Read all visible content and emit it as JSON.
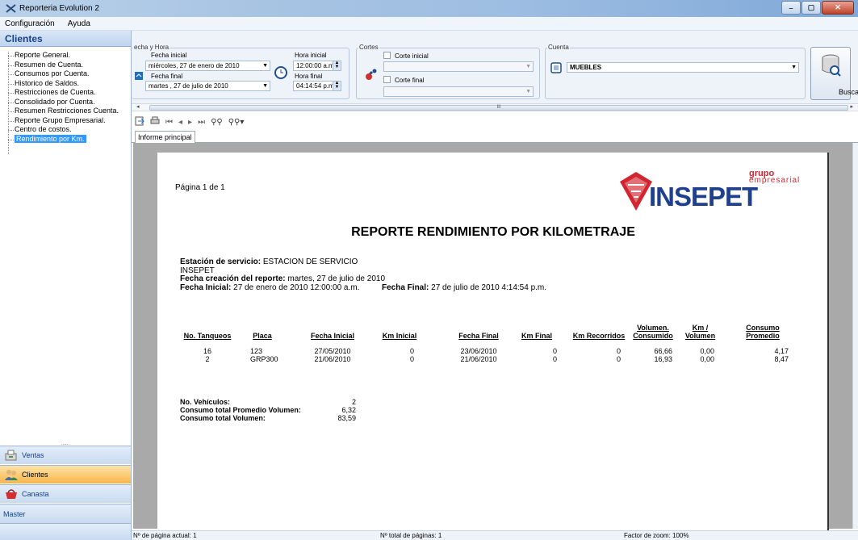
{
  "window": {
    "title": "Reporteria Evolution 2",
    "min": "–",
    "max": "▢",
    "close": "✕"
  },
  "menu": [
    "Configuración",
    "Ayuda"
  ],
  "left": {
    "header": "Clientes",
    "tree": [
      "Reporte General.",
      "Resumen de Cuenta.",
      "Consumos  por Cuenta.",
      "Historico de Saldos.",
      "Restricciones de Cuenta.",
      "Consolidado por Cuenta.",
      "Resumen Restricciones Cuenta.",
      "Reporte Grupo Empresarial.",
      "Centro de costos.",
      "Rendimiento por Km."
    ],
    "selected": 9,
    "splitter": "......",
    "nav": [
      {
        "label": "Ventas",
        "icon": "ventas-icon"
      },
      {
        "label": "Clientes",
        "icon": "clientes-icon"
      },
      {
        "label": "Canasta",
        "icon": "canasta-icon"
      },
      {
        "label": "Master",
        "icon": ""
      }
    ]
  },
  "filters": {
    "fecha_hora_title": "echa y Hora",
    "fecha_inicial_label": "Fecha inicial",
    "fecha_inicial_value": "miércoles, 27 de    enero     de 2010",
    "fecha_final_label": "Fecha final",
    "fecha_final_value": "martes  , 27 de    julio     de 2010",
    "hora_inicial_label": "Hora inicial",
    "hora_inicial_value": "12:00:00 a.m.",
    "hora_final_label": "Hora final",
    "hora_final_value": "04:14:54 p.m.",
    "cortes_title": "Cortes",
    "corte_inicial_label": "Corte inicial",
    "corte_final_label": "Corte final",
    "cuenta_title": "Cuenta",
    "cuenta_value": "MUEBLES",
    "buscar_label": "Buscar",
    "scroll_thumb": "III"
  },
  "tab": "Informe principal",
  "report": {
    "page_label": "Página 1 de 1",
    "logo_top": "grupo",
    "logo_sub": "empresarial",
    "logo_main": "INSEPET",
    "title": "REPORTE RENDIMIENTO POR KILOMETRAJE",
    "estacion_label": "Estación de servicio:",
    "estacion_value": " ESTACION DE SERVICIO",
    "estacion_value2": "INSEPET",
    "fecha_creacion_label": "Fecha creación del reporte:",
    "fecha_creacion_value": " martes, 27 de julio de 2010",
    "fecha_inicial_label": "Fecha Inicial:",
    "fecha_inicial_value": " 27 de enero de 2010  12:00:00 a.m.",
    "fecha_final_label": "Fecha Final:",
    "fecha_final_value": " 27 de julio de 2010   4:14:54 p.m.",
    "columns": [
      "No. Tanqueos",
      "Placa",
      "Fecha Inicial",
      "Km Inicial",
      "Fecha Final",
      "Km Final",
      "Km Recorridos",
      "Volumen.\nConsumido",
      "Km /\nVolumen",
      "Consumo\nPromedio"
    ],
    "rows": [
      [
        "16",
        "123",
        "27/05/2010",
        "0",
        "23/06/2010",
        "0",
        "0",
        "66,66",
        "0,00",
        "4,17"
      ],
      [
        "2",
        "GRP300",
        "21/06/2010",
        "0",
        "21/06/2010",
        "0",
        "0",
        "16,93",
        "0,00",
        "8,47"
      ]
    ],
    "summary": [
      {
        "label": "No. Vehículos:",
        "value": "2"
      },
      {
        "label": "Consumo total Promedio Volumen:",
        "value": "6,32"
      },
      {
        "label": "Consumo total Volumen:",
        "value": "83,59"
      }
    ]
  },
  "status": {
    "pagina_actual": "Nº de página actual: 1",
    "total_paginas": "Nº total de páginas: 1",
    "zoom": "Factor de zoom: 100%"
  },
  "colors": {
    "selection": "#3399ff",
    "active_nav": "#f9b64a",
    "logo_red": "#d3252f",
    "logo_blue": "#1f3f8f"
  }
}
